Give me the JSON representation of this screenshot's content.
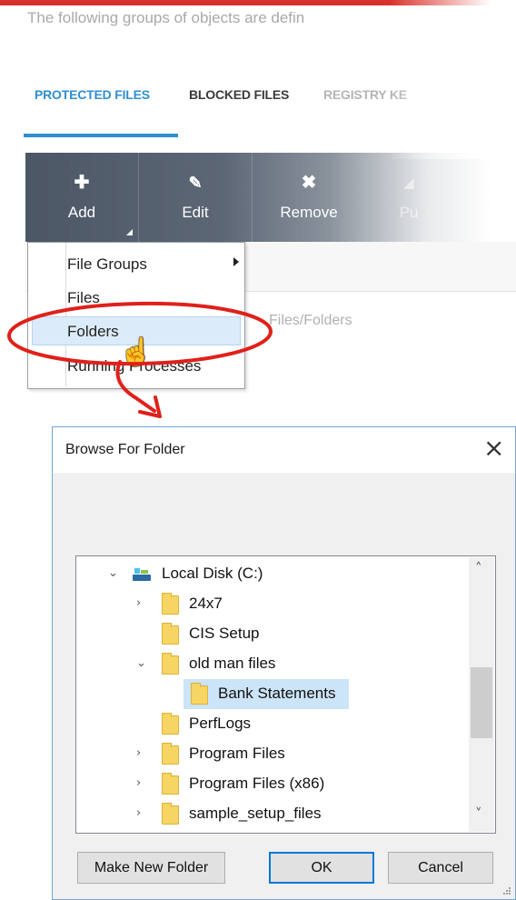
{
  "header": {
    "intro_text": "The following groups of objects are defin"
  },
  "tabs": [
    {
      "label": "PROTECTED FILES",
      "active": true
    },
    {
      "label": "BLOCKED FILES",
      "active": false
    },
    {
      "label": "REGISTRY KE",
      "active": false
    }
  ],
  "toolbar": {
    "add": {
      "label": "Add",
      "icon": "plus-icon"
    },
    "edit": {
      "label": "Edit",
      "icon": "pencil-icon"
    },
    "remove": {
      "label": "Remove",
      "icon": "x-icon"
    },
    "purge": {
      "label": "Pu",
      "icon": "purge-icon"
    }
  },
  "content": {
    "column_text": "Files/Folders"
  },
  "add_menu": {
    "items": [
      {
        "label": "File Groups",
        "submenu": true
      },
      {
        "label": "Files"
      },
      {
        "label": "Folders",
        "highlighted": true
      },
      {
        "label": "Running Processes"
      }
    ]
  },
  "dialog": {
    "title": "Browse For Folder",
    "close_icon": "close-icon",
    "tree": [
      {
        "label": "Local Disk (C:)",
        "expanded": true,
        "icon": "drive-icon"
      },
      {
        "label": "24x7",
        "expandable": true
      },
      {
        "label": "CIS Setup"
      },
      {
        "label": "old man files",
        "expanded": true
      },
      {
        "label": "Bank Statements",
        "selected": true
      },
      {
        "label": "PerfLogs"
      },
      {
        "label": "Program Files",
        "expandable": true
      },
      {
        "label": "Program Files (x86)",
        "expandable": true
      },
      {
        "label": "sample_setup_files",
        "expandable": true
      }
    ],
    "buttons": {
      "new_folder": "Make New Folder",
      "ok": "OK",
      "cancel": "Cancel"
    }
  },
  "colors": {
    "accent_blue": "#2f8fd0",
    "annotation_red": "#e0201a",
    "toolbar_dark": "#4c5765",
    "folder_yellow": "#f7d563"
  }
}
